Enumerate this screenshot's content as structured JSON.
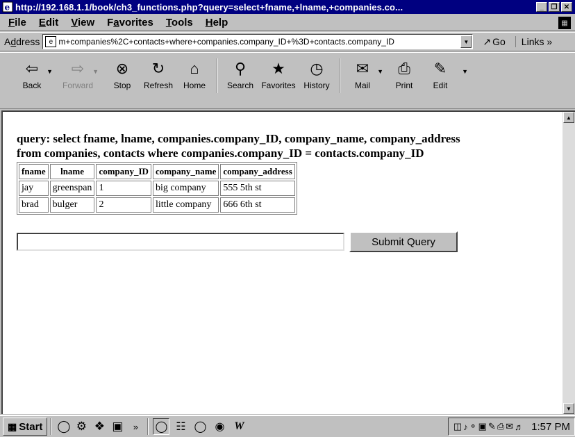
{
  "window": {
    "title": "http://192.168.1.1/book/ch3_functions.php?query=select+fname,+lname,+companies.co..."
  },
  "menu": {
    "file": "ile",
    "file_key": "F",
    "edit": "dit",
    "edit_key": "E",
    "view": "iew",
    "view_key": "V",
    "favorites_pre": "F",
    "favorites_key": "a",
    "favorites_post": "vorites",
    "tools": "ools",
    "tools_key": "T",
    "help": "elp",
    "help_key": "H"
  },
  "address": {
    "label_pre": "A",
    "label_key": "d",
    "label_post": "dress",
    "value": "m+companies%2C+contacts+where+companies.company_ID+%3D+contacts.company_ID",
    "go_label": "Go",
    "links_label": "Links »"
  },
  "toolbar": {
    "back": "Back",
    "forward": "Forward",
    "stop": "Stop",
    "refresh": "Refresh",
    "home": "Home",
    "search": "Search",
    "favorites": "Favorites",
    "history": "History",
    "mail": "Mail",
    "print": "Print",
    "edit": "Edit"
  },
  "content": {
    "query_line1": "query: select fname, lname, companies.company_ID, company_name, company_address",
    "query_line2": "from companies, contacts where companies.company_ID = contacts.company_ID",
    "table": {
      "headers": [
        "fname",
        "lname",
        "company_ID",
        "company_name",
        "company_address"
      ],
      "rows": [
        [
          "jay",
          "greenspan",
          "1",
          "big company",
          "555 5th st"
        ],
        [
          "brad",
          "bulger",
          "2",
          "little company",
          "666 6th st"
        ]
      ]
    },
    "query_input_value": "",
    "submit_label": "Submit Query"
  },
  "taskbar": {
    "start_label": "Start",
    "clock": "1:57 PM"
  }
}
